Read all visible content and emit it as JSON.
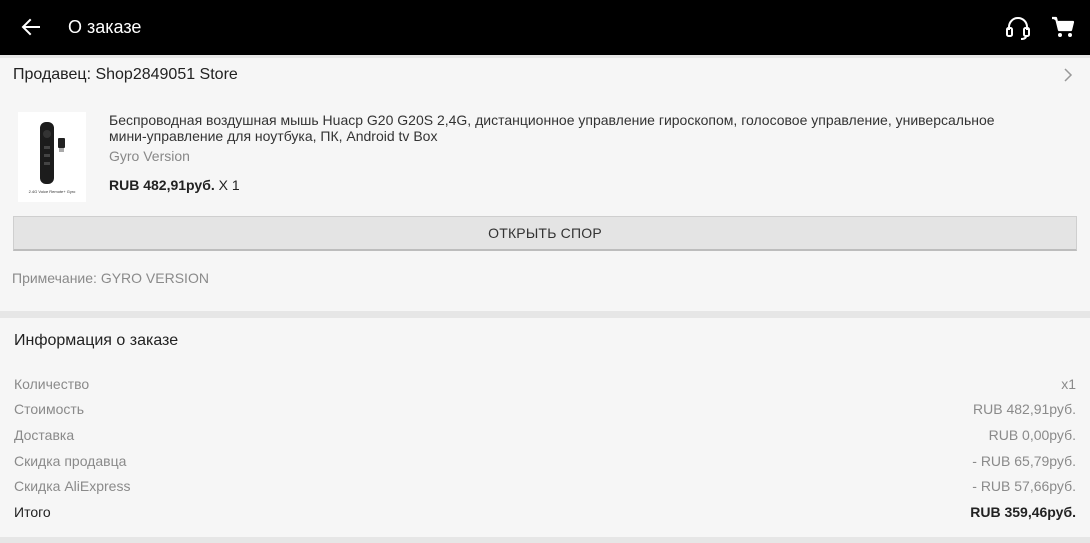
{
  "header": {
    "title": "О заказе",
    "back_icon": "arrow-left-icon",
    "support_icon": "headset-icon",
    "cart_icon": "cart-icon"
  },
  "seller": {
    "label": "Продавец: Shop2849051 Store"
  },
  "product": {
    "title": "Беспроводная воздушная мышь Huacp G20 G20S 2,4G, дистанционное управление гироскопом, голосовое управление, универсальное мини-управление для ноутбука, ПК, Android tv Box",
    "variant": "Gyro Version",
    "price": "RUB 482,91руб.",
    "quantity": "X 1",
    "thumb_caption": "2.4G Voice Remote+ Gyro"
  },
  "dispute_button": "ОТКРЫТЬ СПОР",
  "note": "Примечание: GYRO VERSION",
  "order_info": {
    "title": "Информация о заказе",
    "rows": [
      {
        "label": "Количество",
        "value": "x1"
      },
      {
        "label": "Стоимость",
        "value": "RUB 482,91руб."
      },
      {
        "label": "Доставка",
        "value": "RUB 0,00руб."
      },
      {
        "label": "Скидка продавца",
        "value": "- RUB 65,79руб."
      },
      {
        "label": "Скидка AliExpress",
        "value": "- RUB 57,66руб."
      },
      {
        "label": "Итого",
        "value": "RUB 359,46руб."
      }
    ]
  }
}
